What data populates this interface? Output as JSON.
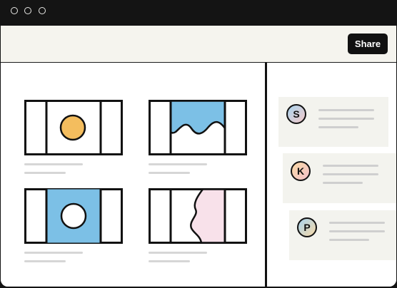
{
  "window": {
    "controls": [
      "window-dot-1",
      "window-dot-2",
      "window-dot-3"
    ]
  },
  "toolbar": {
    "share_label": "Share"
  },
  "thumbnails": [
    {
      "icon": "sun-icon",
      "accent": "#f4bd5e"
    },
    {
      "icon": "wave-icon",
      "accent": "#7cc0e6"
    },
    {
      "icon": "circle-on-blue-icon",
      "accent": "#7cc0e6"
    },
    {
      "icon": "curtain-icon",
      "accent": "#f8e1ea"
    }
  ],
  "comments": [
    {
      "initial": "S",
      "avatar_gradient": [
        "#a9d4ee",
        "#f3c9c9"
      ]
    },
    {
      "initial": "K",
      "avatar_gradient": [
        "#f9d8a4",
        "#f3c2cc"
      ]
    },
    {
      "initial": "P",
      "avatar_gradient": [
        "#a9d4ee",
        "#f7d9a8"
      ]
    }
  ],
  "colors": {
    "titlebar": "#141414",
    "toolbar_bg": "#f5f4ee",
    "comment_bg": "#f3f3ee",
    "button_bg": "#111111",
    "placeholder_line": "#d6d6d6"
  }
}
